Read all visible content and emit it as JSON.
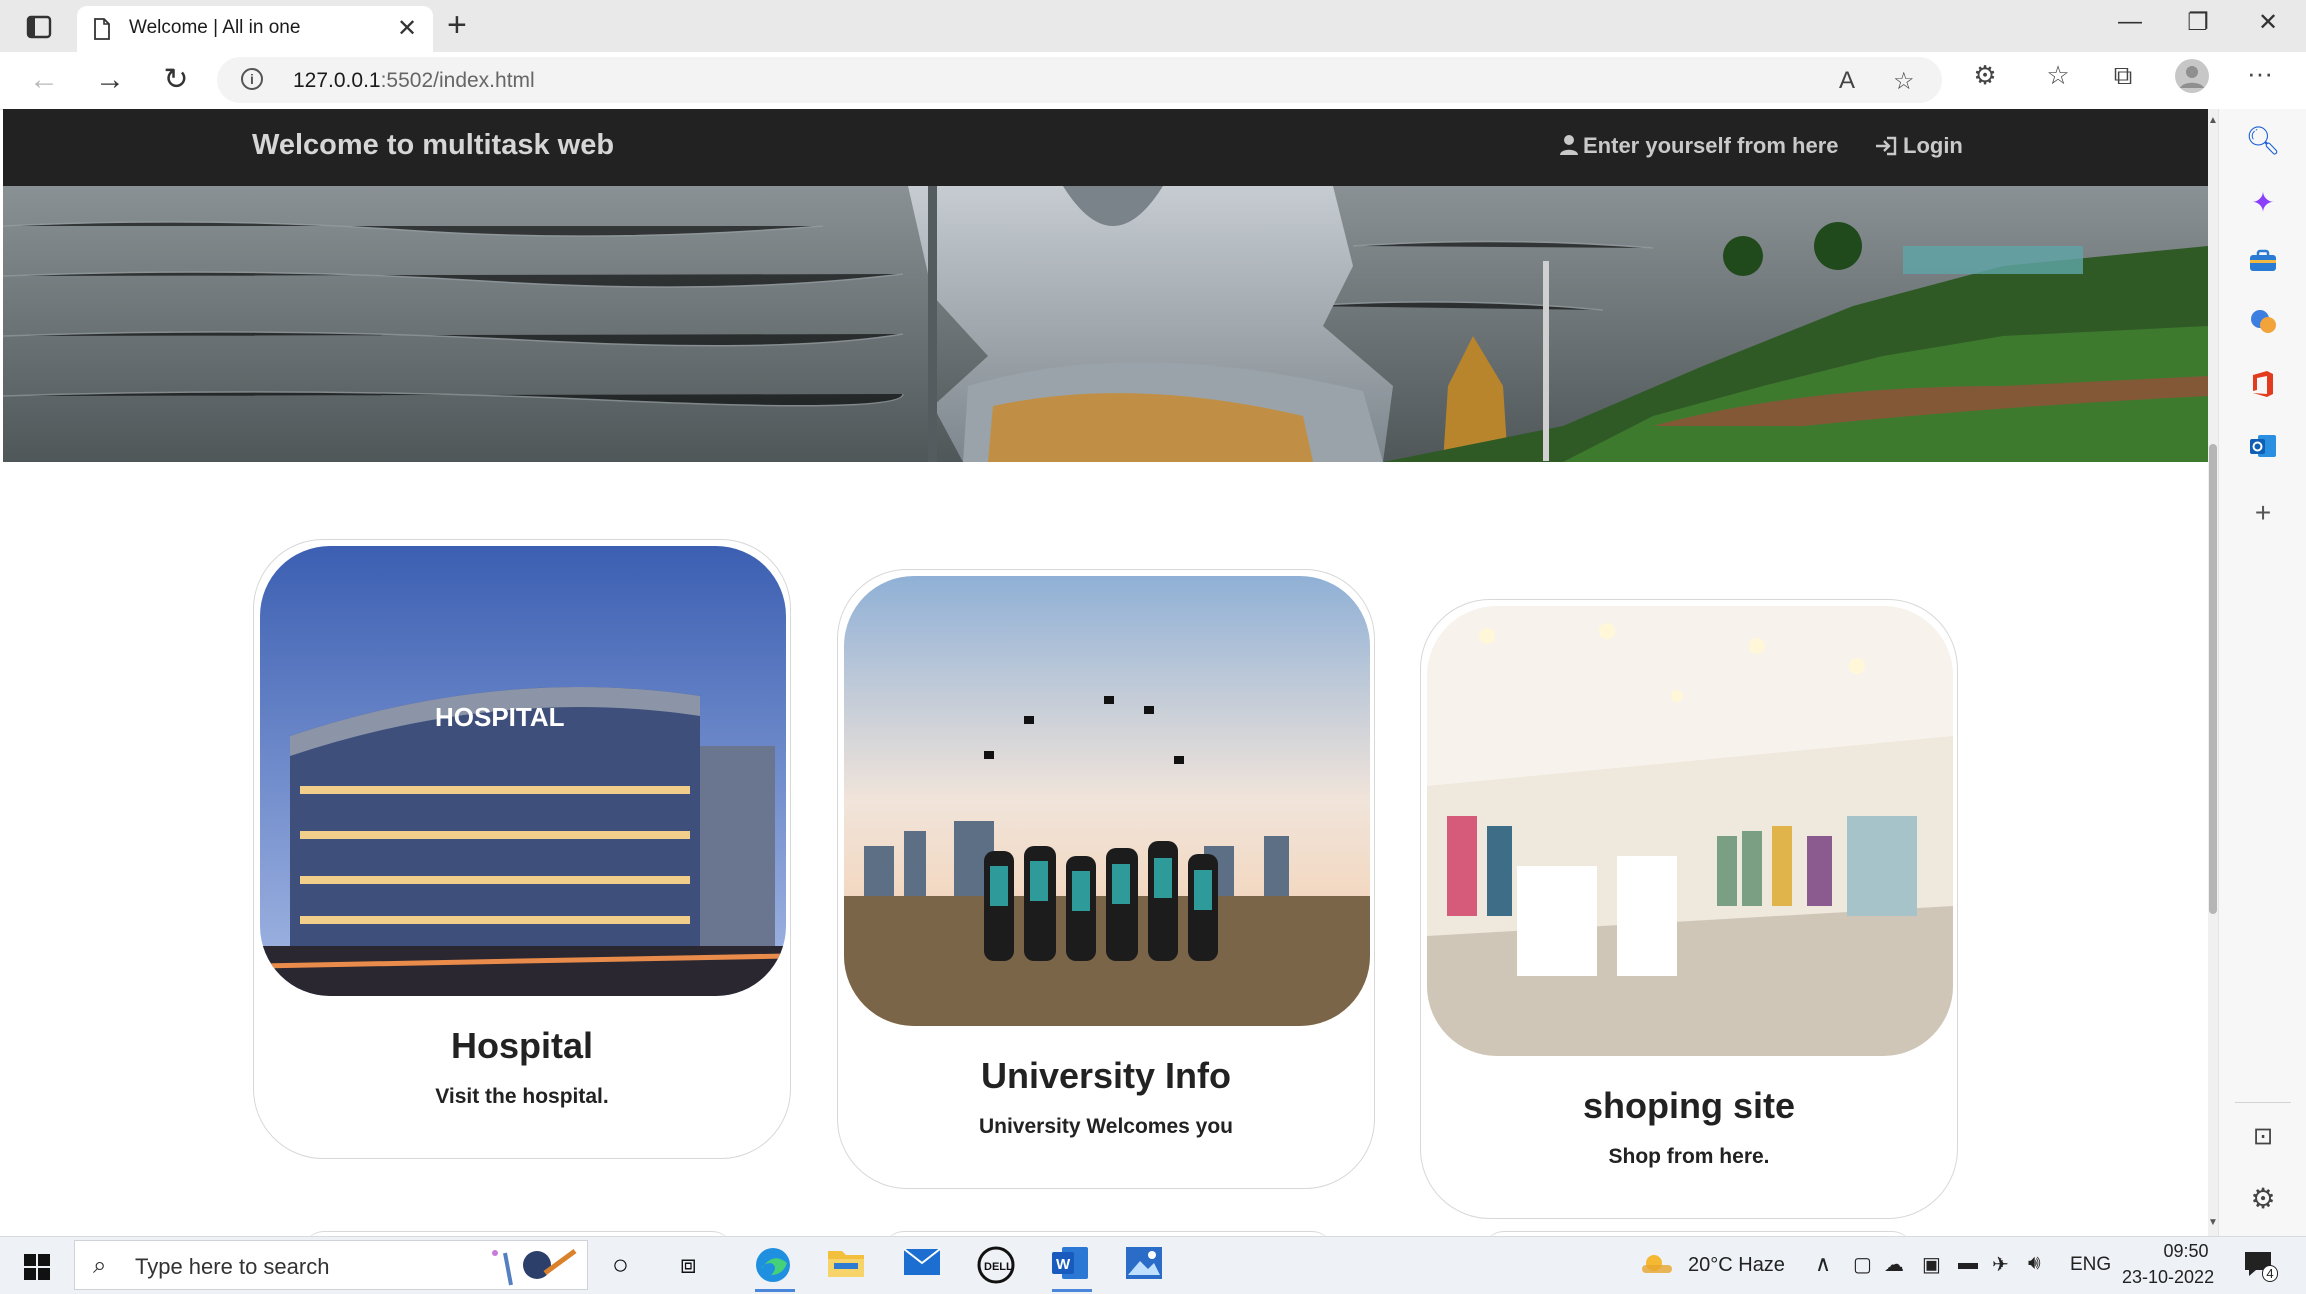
{
  "browser": {
    "tab_title": "Welcome | All in one",
    "url_host": "127.0.0.1",
    "url_rest": ":5502/index.html"
  },
  "site": {
    "brand": "Welcome to multitask web",
    "nav": {
      "register": "Enter yourself from here",
      "login": "Login"
    }
  },
  "cards": [
    {
      "title": "Hospital",
      "text": "Visit the hospital.",
      "image": "hospital-building-photo"
    },
    {
      "title": "University Info",
      "text": "University Welcomes you",
      "image": "graduates-photo"
    },
    {
      "title": "shoping site",
      "text": "Shop from here.",
      "image": "store-interior-photo"
    }
  ],
  "hero": {
    "image": "shiva-statue-seaside-photo"
  },
  "taskbar": {
    "search_placeholder": "Type here to search",
    "weather": "20°C  Haze",
    "language": "ENG",
    "time": "09:50",
    "date": "23-10-2022",
    "notification_count": "4"
  },
  "colors": {
    "navbar": "#222222",
    "card_border": "#d8d8d8",
    "tab_strip": "#e9e9e9"
  }
}
